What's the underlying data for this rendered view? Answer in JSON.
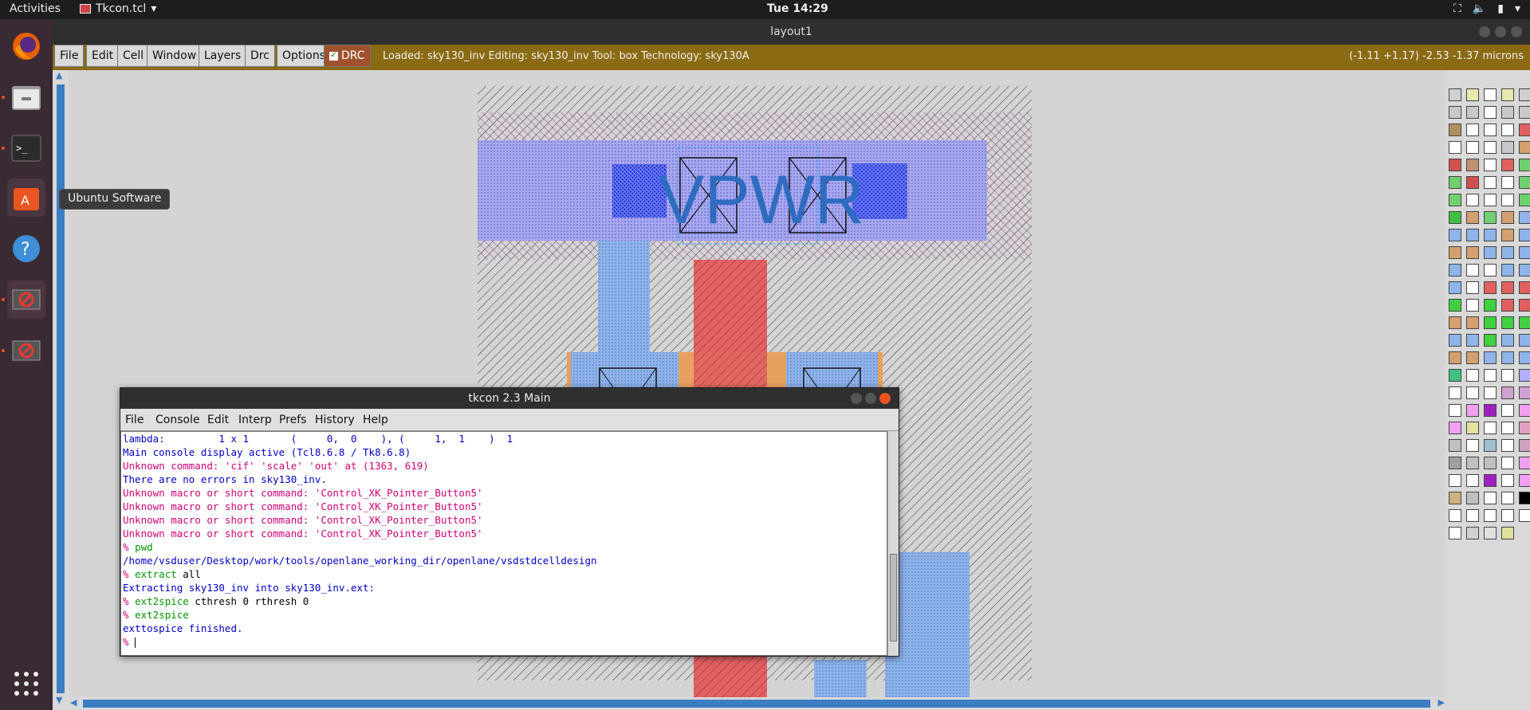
{
  "topbar": {
    "activities": "Activities",
    "app_name": "Tkcon.tcl",
    "clock": "Tue 14:29"
  },
  "dock": {
    "tooltip": "Ubuntu Software",
    "items": [
      "firefox-icon",
      "files-icon",
      "terminal-icon",
      "ubuntu-software-icon",
      "help-icon",
      "window-icon",
      "window-icon",
      "app-grid-icon"
    ]
  },
  "magic": {
    "title": "layout1",
    "menus": [
      "File",
      "Edit",
      "Cell",
      "Window",
      "Layers",
      "Drc",
      "Options"
    ],
    "drc_label": "DRC",
    "drc_checked": true,
    "status": "Loaded: sky130_inv Editing: sky130_inv Tool: box  Technology: sky130A",
    "coords": "(-1.11 +1.17) -2.53 -1.37 microns",
    "label_vpwr": "VPWR",
    "colors": {
      "menubar": "#8a6a12",
      "canvas": "#d4d4d4",
      "metal1": "#a0a0f0",
      "poly": "#e06060",
      "locali": "#6fa0e0"
    }
  },
  "tkcon": {
    "title": "tkcon 2.3 Main",
    "menus": [
      "File",
      "Console",
      "Edit",
      "Interp",
      "Prefs",
      "History",
      "Help"
    ],
    "lines": [
      {
        "color": "blue",
        "text": "lambda:         1 x 1       (     0,  0    ), (     1,  1    )  1"
      },
      {
        "color": "blue",
        "text": "Main console display active (Tcl8.6.8 / Tk8.6.8)"
      },
      {
        "color": "red",
        "text": "Unknown command: 'cif' 'scale' 'out' at (1363, 619)"
      },
      {
        "color": "blue",
        "text": "There are no errors in sky130_inv."
      },
      {
        "color": "red",
        "text": "Unknown macro or short command: 'Control_XK_Pointer_Button5'"
      },
      {
        "color": "red",
        "text": "Unknown macro or short command: 'Control_XK_Pointer_Button5'"
      },
      {
        "color": "red",
        "text": "Unknown macro or short command: 'Control_XK_Pointer_Button5'"
      },
      {
        "color": "red",
        "text": "Unknown macro or short command: 'Control_XK_Pointer_Button5'"
      },
      {
        "color": "cmd",
        "prompt": "% ",
        "cmd": "pwd",
        "args": ""
      },
      {
        "color": "blue",
        "text": "/home/vsduser/Desktop/work/tools/openlane_working_dir/openlane/vsdstdcelldesign"
      },
      {
        "color": "cmd",
        "prompt": "% ",
        "cmd": "extract",
        "args": " all"
      },
      {
        "color": "blue",
        "text": "Extracting sky130_inv into sky130_inv.ext:"
      },
      {
        "color": "cmd",
        "prompt": "% ",
        "cmd": "ext2spice",
        "args": " cthresh 0 rthresh 0"
      },
      {
        "color": "cmd",
        "prompt": "% ",
        "cmd": "ext2spice",
        "args": ""
      },
      {
        "color": "blue",
        "text": "exttospice finished."
      },
      {
        "color": "cmd",
        "prompt": "% ",
        "cmd": "",
        "args": ""
      }
    ]
  }
}
